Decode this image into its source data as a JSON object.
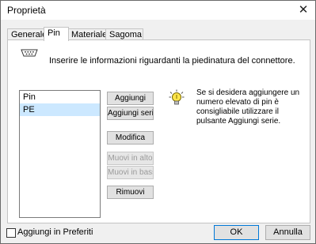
{
  "window": {
    "title": "Proprietà",
    "close_glyph": "✕"
  },
  "tabs": [
    "Generale",
    "Pin",
    "Materiale",
    "Sagoma"
  ],
  "active_tab": "Pin",
  "instruction": "Inserire le informazioni riguardanti la piedinatura del connettore.",
  "pin_list": [
    "Pin",
    "PE"
  ],
  "selected_pin": "PE",
  "buttons": {
    "add": "Aggiungi",
    "add_series": "Aggiungi serie",
    "edit": "Modifica",
    "move_up": "Muovi in alto",
    "move_down": "Muovi in basso",
    "remove": "Rimuovi"
  },
  "hint": "Se si desidera aggiungere un numero elevato di pin è consigliabile utilizzare il pulsante Aggiungi serie.",
  "favorites": {
    "label": "Aggiungi in Preferiti",
    "checked": false
  },
  "footer": {
    "ok": "OK",
    "cancel": "Annulla"
  },
  "icons": {
    "connector": "connector-icon",
    "hint": "lightbulb-icon"
  },
  "colors": {
    "selection": "#cce8ff",
    "default_button_border": "#0078d7"
  }
}
